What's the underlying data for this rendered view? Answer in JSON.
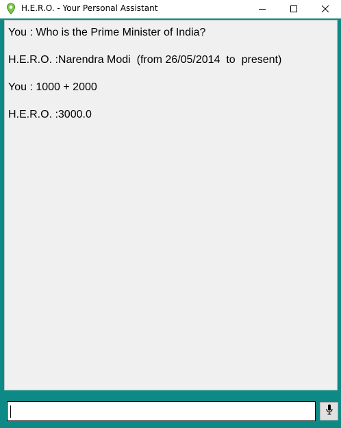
{
  "window": {
    "title": "H.E.R.O. - Your Personal Assistant",
    "accent_color": "#0e8a86"
  },
  "icons": {
    "app": "location-pin-icon",
    "minimize": "minimize-icon",
    "maximize": "maximize-icon",
    "close": "close-icon",
    "mic": "microphone-icon"
  },
  "chat": {
    "messages": [
      {
        "text": "You : Who is the Prime Minister of India?"
      },
      {
        "text": "H.E.R.O. :Narendra Modi  (from 26/05/2014  to  present)"
      },
      {
        "text": "You : 1000 + 2000"
      },
      {
        "text": "H.E.R.O. :3000.0"
      }
    ]
  },
  "input": {
    "value": ""
  }
}
